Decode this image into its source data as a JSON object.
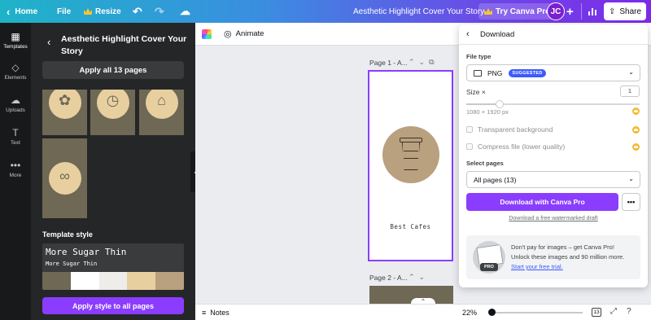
{
  "topbar": {
    "home": "Home",
    "file": "File",
    "resize": "Resize",
    "title": "Aesthetic Highlight Cover Your Story",
    "try_pro": "Try Canva Pro",
    "avatar": "JC",
    "share": "Share",
    "accent_gradient": [
      "#1fb3c8",
      "#3a8ee0",
      "#6c48e8",
      "#7d2ae8"
    ]
  },
  "rail": {
    "items": [
      {
        "label": "Templates",
        "icon": "templates-icon"
      },
      {
        "label": "Elements",
        "icon": "elements-icon"
      },
      {
        "label": "Uploads",
        "icon": "upload-icon"
      },
      {
        "label": "Text",
        "icon": "text-icon"
      },
      {
        "label": "More",
        "icon": "more-icon"
      }
    ]
  },
  "panel": {
    "title": "Aesthetic Highlight Cover Your Story",
    "apply_all": "Apply all 13 pages",
    "template_style_label": "Template style",
    "font_big": "More Sugar Thin",
    "font_small": "More Sugar Thin",
    "swatches": [
      "#6e6855",
      "#ffffff",
      "#eeede9",
      "#e8cfa0",
      "#b9a07e"
    ],
    "apply_style": "Apply style to all pages"
  },
  "toolbar": {
    "animate": "Animate"
  },
  "canvas": {
    "page1_label": "Page 1 - A...",
    "page2_label": "Page 2 - A...",
    "page1_caption": "Best Cafes"
  },
  "bottombar": {
    "notes": "Notes",
    "zoom": "22%",
    "page_count": "13"
  },
  "download": {
    "heading": "Download",
    "file_type_label": "File type",
    "file_type_value": "PNG",
    "suggested_badge": "SUGGESTED",
    "size_label": "Size ×",
    "size_value": "1",
    "size_px": "1080 × 1920 px",
    "transparent_bg": "Transparent background",
    "compress": "Compress file (lower quality)",
    "select_pages_label": "Select pages",
    "pages_value": "All pages (13)",
    "download_pro": "Download with Canva Pro",
    "free_link": "Download a free watermarked draft",
    "promo_pro_tag": "PRO",
    "promo_text": "Don't pay for images – get Canva Pro! Unlock these images and 90 million more.",
    "promo_link": "Start your free trial."
  }
}
